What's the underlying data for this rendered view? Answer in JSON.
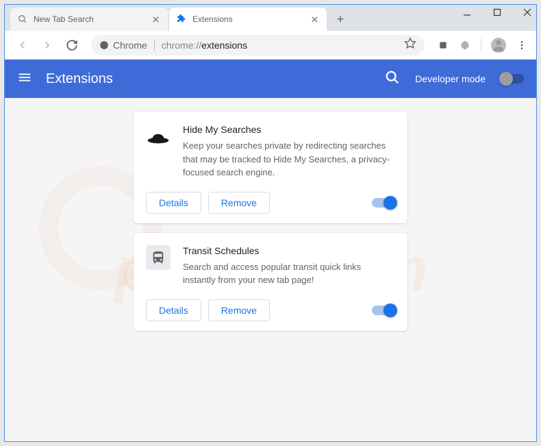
{
  "window": {
    "tabs": [
      {
        "title": "New Tab Search",
        "active": false
      },
      {
        "title": "Extensions",
        "active": true
      }
    ]
  },
  "addressBar": {
    "siteLabel": "Chrome",
    "urlPrefix": "chrome://",
    "urlPath": "extensions"
  },
  "appBar": {
    "title": "Extensions",
    "devModeLabel": "Developer mode"
  },
  "extensions": [
    {
      "name": "Hide My Searches",
      "description": "Keep your searches private by redirecting searches that may be tracked to Hide My Searches, a privacy-focused search engine.",
      "detailsLabel": "Details",
      "removeLabel": "Remove",
      "enabled": true,
      "iconType": "hat"
    },
    {
      "name": "Transit Schedules",
      "description": "Search and access popular transit quick links instantly from your new tab page!",
      "detailsLabel": "Details",
      "removeLabel": "Remove",
      "enabled": true,
      "iconType": "transit"
    }
  ],
  "watermark": "pcrisk.com"
}
